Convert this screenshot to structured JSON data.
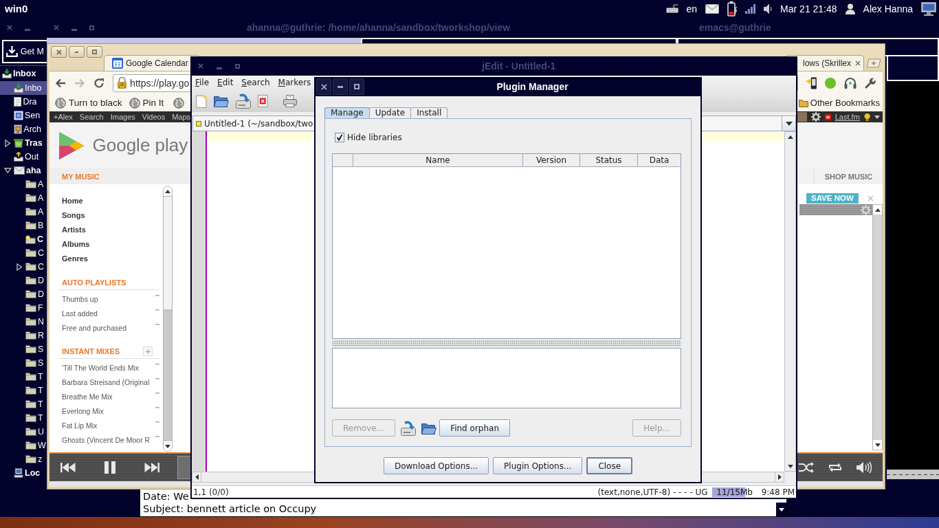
{
  "top_panel": {
    "workspace": "win0",
    "keyboard_layout": "en",
    "clock": "Mar 21 21:48",
    "user": "Alex Hanna"
  },
  "mail_window": {
    "get_mail_button": "Get M",
    "folders": [
      {
        "label": "Inbox",
        "kind": "inbox",
        "unread": true,
        "selected": false,
        "children": [
          {
            "label": "Inbo",
            "kind": "inbox",
            "unread": false,
            "selected": true
          },
          {
            "label": "Dra",
            "kind": "drafts",
            "unread": false,
            "selected": false
          },
          {
            "label": "Sen",
            "kind": "sent",
            "unread": false,
            "selected": false
          },
          {
            "label": "Arch",
            "kind": "archive",
            "unread": false,
            "selected": false
          },
          {
            "label": "Tras",
            "kind": "trash",
            "unread": true,
            "selected": false,
            "expanded": false
          },
          {
            "label": "Out",
            "kind": "outbox",
            "unread": false,
            "selected": false
          },
          {
            "label": "aha",
            "kind": "account",
            "unread": true,
            "selected": false,
            "expanded": true,
            "children": [
              {
                "label": "A",
                "kind": "folder",
                "unread": false,
                "selected": false
              },
              {
                "label": "A",
                "kind": "folder",
                "unread": false,
                "selected": false
              },
              {
                "label": "A",
                "kind": "folder",
                "unread": false,
                "selected": false
              },
              {
                "label": "B",
                "kind": "folder",
                "unread": false,
                "selected": false
              },
              {
                "label": "C",
                "kind": "folder_new",
                "unread": true,
                "selected": false
              },
              {
                "label": "C",
                "kind": "folder",
                "unread": false,
                "selected": false
              },
              {
                "label": "C",
                "kind": "folder",
                "unread": false,
                "selected": false,
                "expanded": false
              },
              {
                "label": "D",
                "kind": "folder",
                "unread": false,
                "selected": false
              },
              {
                "label": "D",
                "kind": "folder",
                "unread": false,
                "selected": false
              },
              {
                "label": "F",
                "kind": "folder",
                "unread": false,
                "selected": false
              },
              {
                "label": "N",
                "kind": "folder",
                "unread": false,
                "selected": false
              },
              {
                "label": "R",
                "kind": "folder",
                "unread": false,
                "selected": false
              },
              {
                "label": "S",
                "kind": "folder",
                "unread": false,
                "selected": false
              },
              {
                "label": "S",
                "kind": "folder",
                "unread": false,
                "selected": false
              },
              {
                "label": "T",
                "kind": "folder",
                "unread": false,
                "selected": false
              },
              {
                "label": "T",
                "kind": "folder",
                "unread": false,
                "selected": false
              },
              {
                "label": "T",
                "kind": "folder",
                "unread": false,
                "selected": false
              },
              {
                "label": "T",
                "kind": "folder",
                "unread": false,
                "selected": false
              },
              {
                "label": "U",
                "kind": "folder",
                "unread": false,
                "selected": false
              },
              {
                "label": "W",
                "kind": "folder",
                "unread": false,
                "selected": false
              },
              {
                "label": "z",
                "kind": "folder",
                "unread": false,
                "selected": false
              }
            ]
          },
          {
            "label": "Loc",
            "kind": "local",
            "unread": true,
            "selected": false
          }
        ]
      }
    ],
    "message_header": [
      "Date: We",
      "Subject: bennett article on Occupy"
    ]
  },
  "terminal_window": {
    "title": "ahanna@guthrie: /home/ahanna/sandbox/tworkshop/view"
  },
  "emacs_window": {
    "title": "emacs@guthrie"
  },
  "browser": {
    "tabs": [
      {
        "label": "Google Calendar",
        "kind": "calendar"
      },
      {
        "label": "lows (Skrillex",
        "kind": "music"
      }
    ],
    "url": "https://play.go",
    "bookmarks": [
      "Turn to black",
      "Pin It"
    ],
    "other_bookmarks": "Other Bookmarks",
    "google_bar": {
      "links": [
        "+Alex",
        "Search",
        "Images",
        "Videos",
        "Maps"
      ],
      "service_link": "Last.fm"
    },
    "play": {
      "logo_text": "Google play",
      "sections": [
        {
          "title": "MY MUSIC",
          "kind": "nav",
          "items": [
            "Home",
            "Songs",
            "Artists",
            "Albums",
            "Genres"
          ]
        },
        {
          "title": "AUTO PLAYLISTS",
          "kind": "playlists",
          "addable": false,
          "items": [
            "Thumbs up",
            "Last added",
            "Free and purchased"
          ]
        },
        {
          "title": "INSTANT MIXES",
          "kind": "playlists",
          "addable": true,
          "items": [
            "'Till The World Ends Mix",
            "Barbara Streisand (Original",
            "Breathe Me Mix",
            "Everlong Mix",
            "Fat Lip Mix",
            "Ghosts (Vincent De Moor R"
          ]
        }
      ],
      "shop_tab": "SHOP MUSIC",
      "promo_button": "SAVE NOW"
    }
  },
  "jedit": {
    "title": "jEdit - Untitled-1",
    "menu": [
      "File",
      "Edit",
      "Search",
      "Markers"
    ],
    "buffer": "Untitled-1 (~/sandbox/two",
    "status": {
      "caret": "1,1 (0/0)",
      "mode": "(text,none,UTF-8) - - - - UG",
      "memory": {
        "reading": "11/15Mb",
        "level": 0.73
      },
      "clock": "9:48 PM"
    }
  },
  "plugin_manager": {
    "title": "Plugin Manager",
    "tabs": [
      {
        "label": "Manage",
        "selected": true
      },
      {
        "label": "Update",
        "selected": false
      },
      {
        "label": "Install",
        "selected": false
      }
    ],
    "hide_libraries": {
      "label": "Hide libraries",
      "checked": true
    },
    "columns": [
      "Name",
      "Version",
      "Status",
      "Data"
    ],
    "left_actions": [
      {
        "label": "Remove...",
        "disabled": true
      },
      {
        "label": "Find orphan",
        "disabled": false
      }
    ],
    "right_actions": [
      {
        "label": "Help...",
        "disabled": true
      }
    ],
    "footer_buttons": [
      {
        "label": "Download Options...",
        "focused": false
      },
      {
        "label": "Plugin Options...",
        "focused": false
      },
      {
        "label": "Close",
        "focused": true
      }
    ]
  }
}
